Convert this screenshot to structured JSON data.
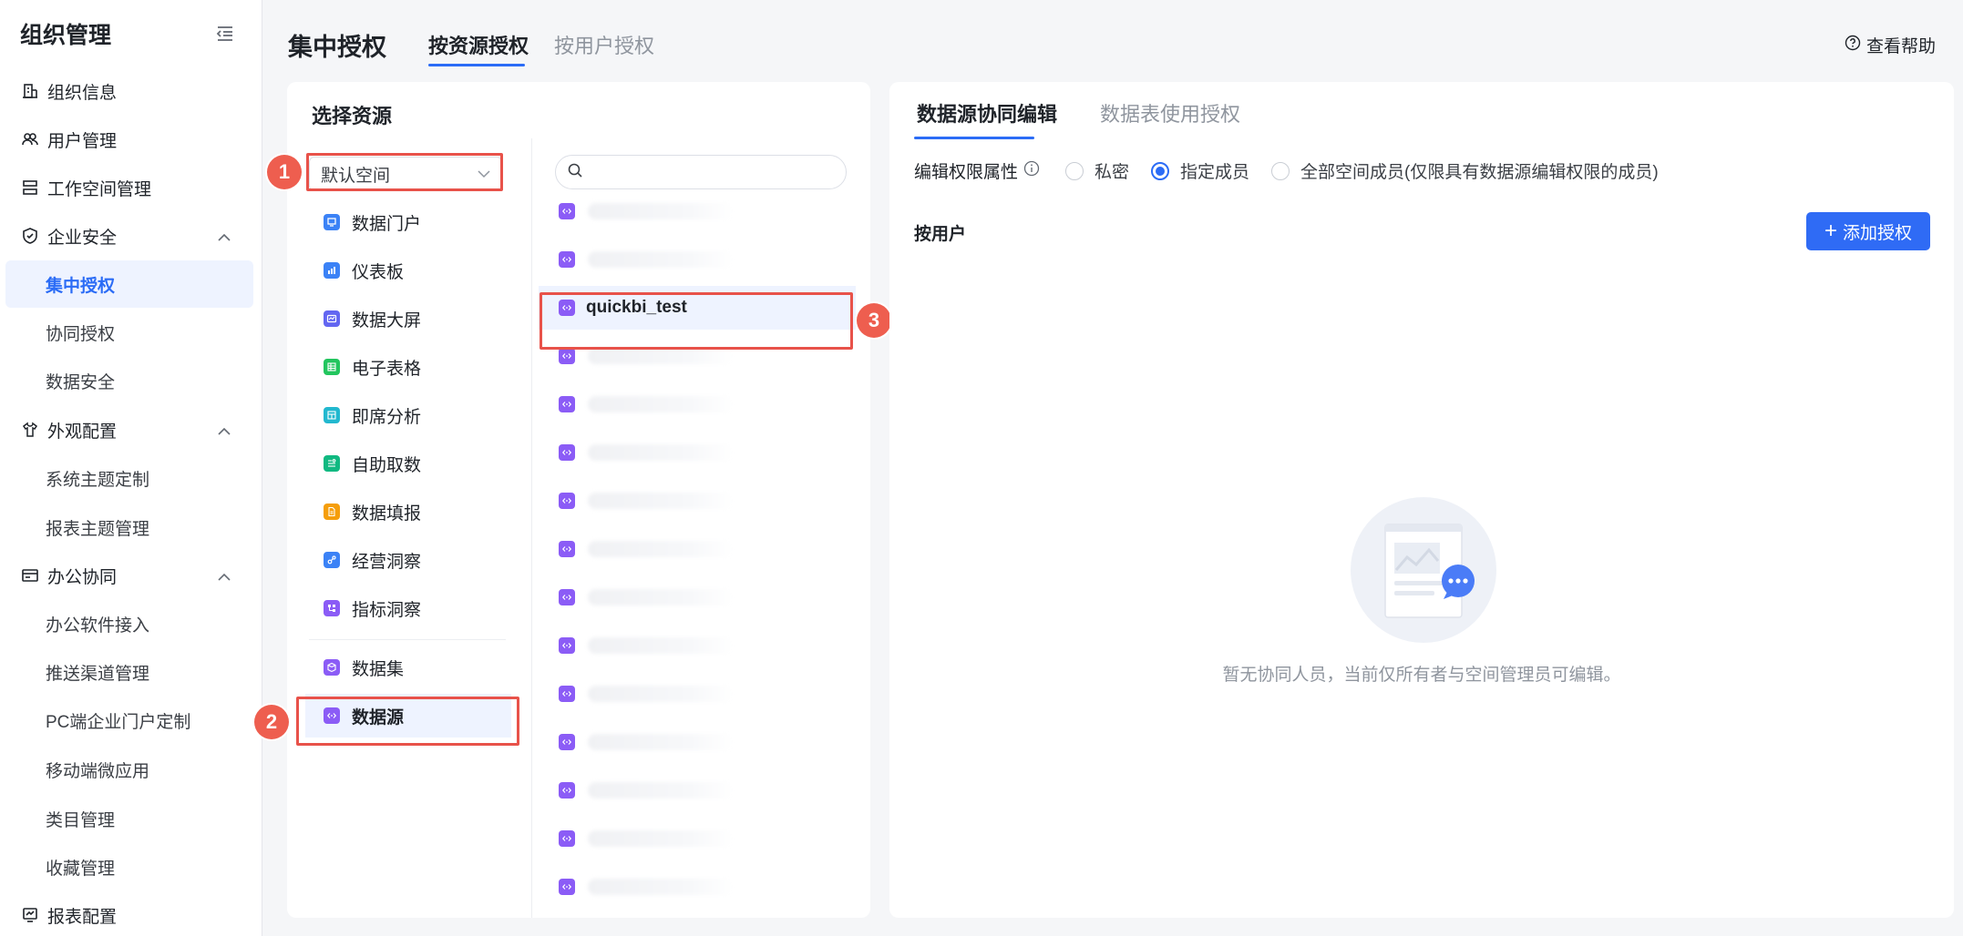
{
  "sidebar": {
    "title": "组织管理",
    "items": [
      {
        "label": "组织信息",
        "icon": "building-icon"
      },
      {
        "label": "用户管理",
        "icon": "users-icon"
      },
      {
        "label": "工作空间管理",
        "icon": "workspace-icon"
      },
      {
        "label": "企业安全",
        "icon": "shield-icon",
        "expanded": true
      },
      {
        "label": "集中授权",
        "active": true
      },
      {
        "label": "协同授权"
      },
      {
        "label": "数据安全"
      },
      {
        "label": "外观配置",
        "icon": "shirt-icon",
        "expanded": true
      },
      {
        "label": "系统主题定制"
      },
      {
        "label": "报表主题管理"
      },
      {
        "label": "办公协同",
        "icon": "office-icon",
        "expanded": true
      },
      {
        "label": "办公软件接入"
      },
      {
        "label": "推送渠道管理"
      },
      {
        "label": "PC端企业门户定制"
      },
      {
        "label": "移动端微应用"
      },
      {
        "label": "类目管理"
      },
      {
        "label": "收藏管理"
      },
      {
        "label": "报表配置",
        "icon": "report-icon"
      }
    ]
  },
  "header": {
    "title": "集中授权",
    "tabs": [
      {
        "label": "按资源授权",
        "active": true
      },
      {
        "label": "按用户授权",
        "active": false
      }
    ],
    "help_label": "查看帮助"
  },
  "resource_panel": {
    "title": "选择资源",
    "space_select_value": "默认空间",
    "categories": [
      {
        "label": "数据门户",
        "color": "#3b82f6"
      },
      {
        "label": "仪表板",
        "color": "#3b82f6"
      },
      {
        "label": "数据大屏",
        "color": "#6366f1"
      },
      {
        "label": "电子表格",
        "color": "#22c55e"
      },
      {
        "label": "即席分析",
        "color": "#22b8cf"
      },
      {
        "label": "自助取数",
        "color": "#10b981"
      },
      {
        "label": "数据填报",
        "color": "#f59e0b"
      },
      {
        "label": "经营洞察",
        "color": "#3b82f6"
      },
      {
        "label": "指标洞察",
        "color": "#8b5cf6"
      },
      {
        "label": "数据集",
        "color": "#8b5cf6"
      },
      {
        "label": "数据源",
        "color": "#8b5cf6",
        "selected": true
      }
    ],
    "search_placeholder": "",
    "datasources": [
      {
        "name": ""
      },
      {
        "name": ""
      },
      {
        "name": "quickbi_test",
        "selected": true
      },
      {
        "name": ""
      },
      {
        "name": ""
      },
      {
        "name": ""
      },
      {
        "name": ""
      },
      {
        "name": ""
      },
      {
        "name": ""
      },
      {
        "name": ""
      },
      {
        "name": ""
      },
      {
        "name": ""
      },
      {
        "name": ""
      },
      {
        "name": ""
      },
      {
        "name": ""
      }
    ]
  },
  "callouts": [
    "1",
    "2",
    "3"
  ],
  "right_panel": {
    "tabs": [
      {
        "label": "数据源协同编辑",
        "active": true
      },
      {
        "label": "数据表使用授权",
        "active": false
      }
    ],
    "perm_label": "编辑权限属性",
    "radios": [
      {
        "label": "私密",
        "checked": false
      },
      {
        "label": "指定成员",
        "checked": true
      },
      {
        "label": "全部空间成员(仅限具有数据源编辑权限的成员)",
        "checked": false
      }
    ],
    "by_user_label": "按用户",
    "add_button_label": "添加授权",
    "empty_text": "暂无协同人员，当前仅所有者与空间管理员可编辑。"
  },
  "colors": {
    "primary": "#2b6cf6",
    "callout": "#e8524a"
  }
}
